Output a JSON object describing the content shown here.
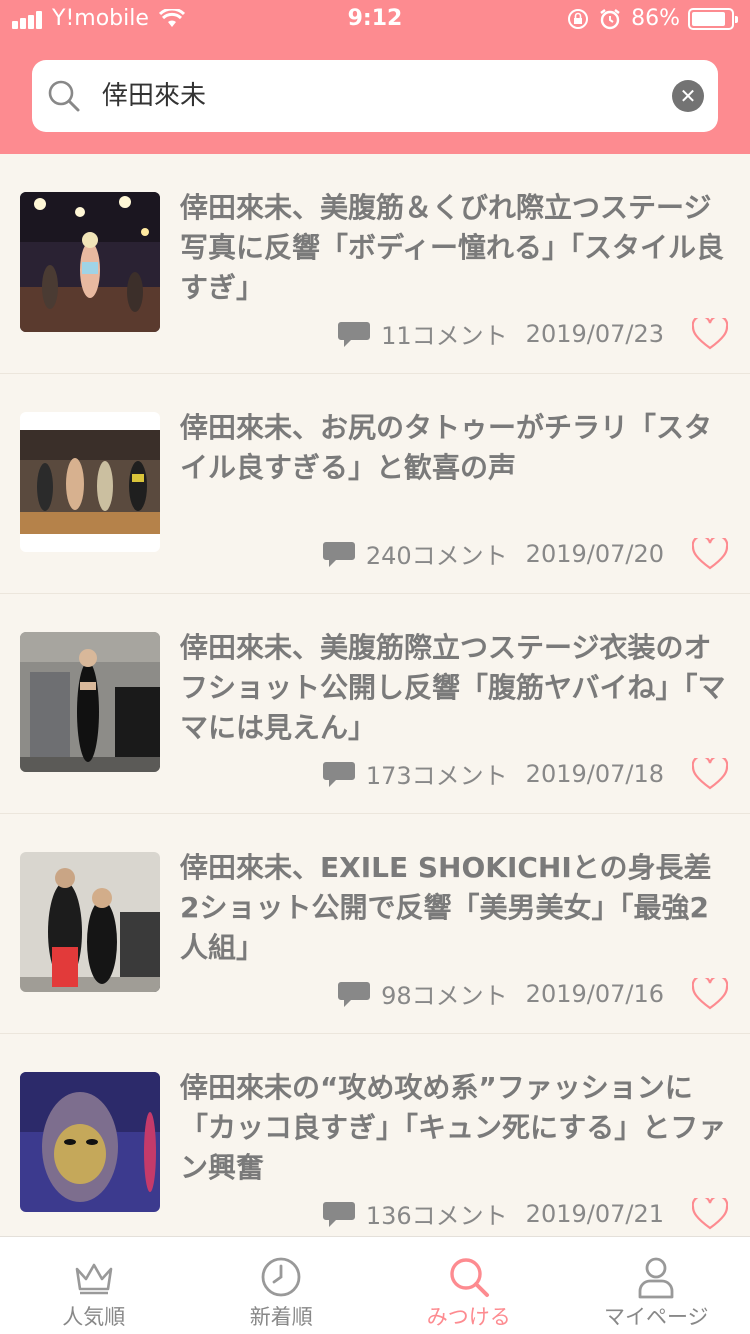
{
  "status_bar": {
    "carrier": "Y!mobile",
    "time": "9:12",
    "battery": "86%",
    "battery_level": 0.86
  },
  "search": {
    "query": "倖田來未",
    "icon": "search-icon",
    "clear_icon": "close-icon"
  },
  "articles": [
    {
      "title": "倖田來未、美腹筋＆くびれ際立つステージ写真に反響「ボディー憧れる」「スタイル良すぎ」",
      "comments": "11コメント",
      "date": "2019/07/23"
    },
    {
      "title": "倖田來未、お尻のタトゥーがチラリ「スタイル良すぎる」と歓喜の声",
      "comments": "240コメント",
      "date": "2019/07/20"
    },
    {
      "title": "倖田來未、美腹筋際立つステージ衣装のオフショット公開し反響「腹筋ヤバイね」「ママには見えん」",
      "comments": "173コメント",
      "date": "2019/07/18"
    },
    {
      "title": "倖田來未、EXILE SHOKICHIとの身長差2ショット公開で反響「美男美女」「最強2人組」",
      "comments": "98コメント",
      "date": "2019/07/16"
    },
    {
      "title": "倖田來未の“攻め攻め系”ファッションに「カッコ良すぎ」「キュン死にする」とファン興奮",
      "comments": "136コメント",
      "date": "2019/07/21"
    }
  ],
  "tabs": [
    {
      "label": "人気順",
      "icon": "crown-icon"
    },
    {
      "label": "新着順",
      "icon": "clock-icon"
    },
    {
      "label": "みつける",
      "icon": "search-icon"
    },
    {
      "label": "マイページ",
      "icon": "person-icon"
    }
  ],
  "colors": {
    "accent": "#fd8b90",
    "background": "#f9f5ee"
  }
}
